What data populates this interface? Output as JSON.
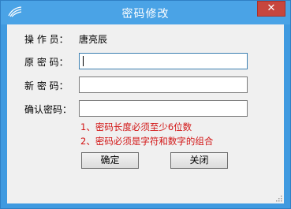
{
  "window": {
    "title": "密码修改",
    "close_label": "✕",
    "icon": "app-logo-icon"
  },
  "form": {
    "operator_label": "操 作 员：",
    "operator_name": "唐亮辰",
    "old_password_label": "原 密 码：",
    "old_password_value": "",
    "new_password_label": "新 密 码：",
    "new_password_value": "",
    "confirm_password_label": "确认密码：",
    "confirm_password_value": ""
  },
  "hints": [
    "1、密码长度必须至少6位数",
    "2、密码必须是字符和数字的组合"
  ],
  "buttons": {
    "ok_label": "确定",
    "close_label": "关闭"
  },
  "colors": {
    "frame": "#4aa3e6",
    "close_button": "#c7463e",
    "client_bg": "#f0f0f0",
    "hint_text": "#d21414"
  }
}
